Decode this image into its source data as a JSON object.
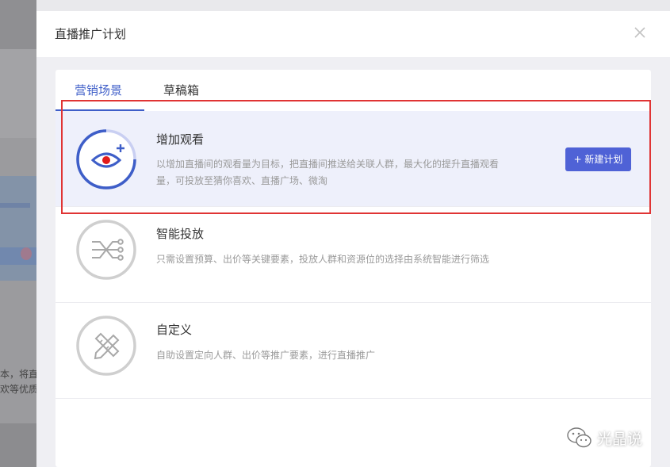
{
  "background": {
    "text_lines": [
      "本，将直",
      "欢等优质"
    ]
  },
  "modal": {
    "title": "直播推广计划",
    "close_symbol": "×"
  },
  "tabs": [
    {
      "label": "营销场景",
      "active": true
    },
    {
      "label": "草稿箱",
      "active": false
    }
  ],
  "cards": [
    {
      "title": "增加观看",
      "description": "以增加直播间的观看量为目标，把直播间推送给关联人群，最大化的提升直播观看量，可投放至猜你喜欢、直播广场、微淘",
      "icon": "eye-plus-icon",
      "selected": true,
      "button": "+ 新建计划"
    },
    {
      "title": "智能投放",
      "description": "只需设置预算、出价等关键要素，投放人群和资源位的选择由系统智能进行筛选",
      "icon": "smart-routing-icon",
      "selected": false
    },
    {
      "title": "自定义",
      "description": "自助设置定向人群、出价等推广要素，进行直播推广",
      "icon": "pencil-ruler-icon",
      "selected": false
    }
  ],
  "watermark": {
    "text": "光晶说",
    "icon": "wechat-icon"
  },
  "colors": {
    "accent": "#3e5ec8",
    "button": "#4f62d6",
    "highlight": "#e03434",
    "selected_bg": "#eef0fb"
  }
}
